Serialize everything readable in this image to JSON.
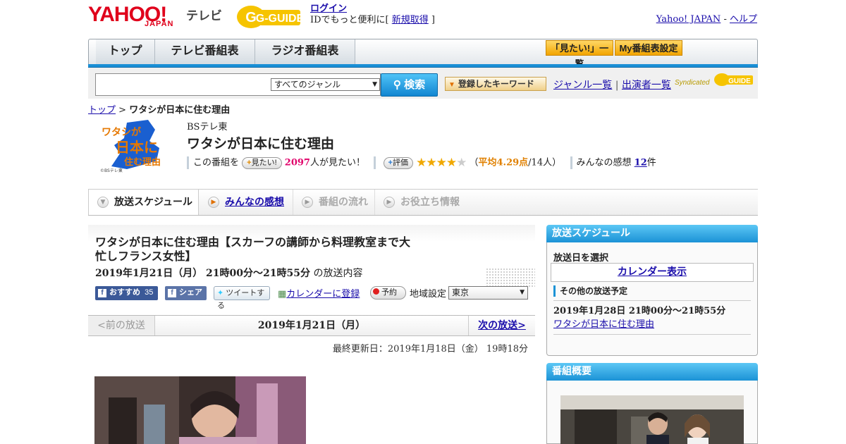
{
  "header": {
    "logo_yahoo": "YAHOO!",
    "logo_japan": "JAPAN",
    "logo_tv": "テレビ",
    "gguide_logo": "G-GUIDE",
    "login_link": "ログイン",
    "login_desc": "IDでもっと便利に[ ",
    "signup_link": "新規取得",
    "signup_close": " ]",
    "yahoo_japan_link": "Yahoo! JAPAN",
    "separator": " - ",
    "help_link": "ヘルプ"
  },
  "nav": {
    "tabs": [
      {
        "label": "トップ"
      },
      {
        "label": "テレビ番組表"
      },
      {
        "label": "ラジオ番組表"
      }
    ],
    "mitai_list": "「見たい!」一覧",
    "my_bangumi": "My番組表設定"
  },
  "search": {
    "genre": "すべてのジャンル",
    "button": "検索",
    "keyword_button": "登録したキーワード",
    "genre_list": "ジャンル一覧",
    "divider": "|",
    "performer_list": "出演者一覧",
    "syndicated": "Syndicated"
  },
  "breadcrumb": {
    "top": "トップ",
    "sep": " > ",
    "current": "ワタシが日本に住む理由"
  },
  "program": {
    "thumb_text": "ワタシが日本に住む理由",
    "thumb_credit": "©BSテレ東",
    "channel": "BSテレ東",
    "title": "ワタシが日本に住む理由",
    "mitai_prefix": "この番組を",
    "mitai_button": "見たい!",
    "mitai_count": "2097",
    "mitai_suffix": "人が見たい！",
    "rate_button": "評価",
    "rating": 4.29,
    "avg_open": "（",
    "avg_label": "平均4.29点",
    "avg_count": "/14人）",
    "reviews_label": "みんなの感想",
    "reviews_count": "12",
    "reviews_unit": "件"
  },
  "tabs": [
    {
      "label": "放送スケジュール"
    },
    {
      "label": "みんなの感想"
    },
    {
      "label": "番組の流れ"
    },
    {
      "label": "お役立ち情報"
    }
  ],
  "episode": {
    "title": "ワタシが日本に住む理由【スカーフの講師から料理教室まで大忙しフランス女性】",
    "datetime": "2019年1月21日（月） 21時00分～21時55分",
    "datetime_suffix": " の放送内容",
    "fb_recommend": "おすすめ",
    "fb_count": "35",
    "fb_share": "シェア",
    "tweet": "ツイートする",
    "calendar_link": "カレンダーに登録",
    "reserve": "予約",
    "region_label": "地域設定",
    "region_value": "東京",
    "prev": "<前の放送",
    "current_date": "2019年1月21日（月）",
    "next": "次の放送>",
    "updated": "最終更新日：2019年1月18日（金） 19時18分"
  },
  "sidebar": {
    "schedule_head": "放送スケジュール",
    "select_date": "放送日を選択",
    "calendar_button": "カレンダー表示",
    "other_head": "その他の放送予定",
    "other_date": "2019年1月28日 21時00分～21時55分",
    "other_link": "ワタシが日本に住む理由",
    "overview_head": "番組概要"
  },
  "colors": {
    "yahoo_red": "#e0001b",
    "accent_blue": "#1b92d6",
    "link": "#1a0dab",
    "highlight_pink": "#e0006a",
    "star": "#f0a800"
  }
}
